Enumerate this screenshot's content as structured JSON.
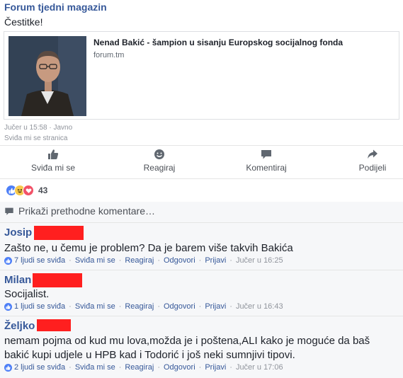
{
  "post": {
    "page_name": "Forum tjedni magazin",
    "text": "Čestitke!",
    "link": {
      "title": "Nenad Bakić - šampion u sisanju Europskog socijalnog fonda",
      "domain": "forum.tm"
    },
    "timestamp": "Jučer u 15:58",
    "privacy": "Javno",
    "page_like": "Sviđa mi se stranica"
  },
  "actions": {
    "like": "Sviđa mi se",
    "react": "Reagiraj",
    "comment": "Komentiraj",
    "share": "Podijeli"
  },
  "reactions": {
    "count": "43",
    "types": [
      "like-icon",
      "haha-icon",
      "love-icon"
    ]
  },
  "comments_section": {
    "show_previous": "Prikaži prethodne komentare…"
  },
  "comments": [
    {
      "author": "Josip",
      "text": "Zašto ne, u čemu je problem? Da je barem više takvih Bakića",
      "likes": "7 ljudi se sviđa",
      "like_link": "Sviđa mi se",
      "react_link": "Reagiraj",
      "reply_link": "Odgovori",
      "report_link": "Prijavi",
      "time": "Jučer u 16:25"
    },
    {
      "author": "Milan",
      "text": "Socijalist.",
      "likes": "1 ljudi se sviđa",
      "like_link": "Sviđa mi se",
      "react_link": "Reagiraj",
      "reply_link": "Odgovori",
      "report_link": "Prijavi",
      "time": "Jučer u 16:43"
    },
    {
      "author": "Željko",
      "text_line1": "nemam pojma od kud mu lova,možda je i poštena,ALI kako je moguće da baš",
      "text_line2": "bakić kupi udjele u HPB kad i Todorić i još neki sumnjivi tipovi.",
      "likes": "2 ljudi se sviđa",
      "like_link": "Sviđa mi se",
      "react_link": "Reagiraj",
      "reply_link": "Odgovori",
      "report_link": "Prijavi",
      "time": "Jučer u 17:06"
    }
  ],
  "colors": {
    "link_blue": "#365899",
    "redaction": "#ff1f1f",
    "like_blue": "#4d7ff7",
    "love_red": "#f25268",
    "haha_yellow": "#f7c94b"
  }
}
